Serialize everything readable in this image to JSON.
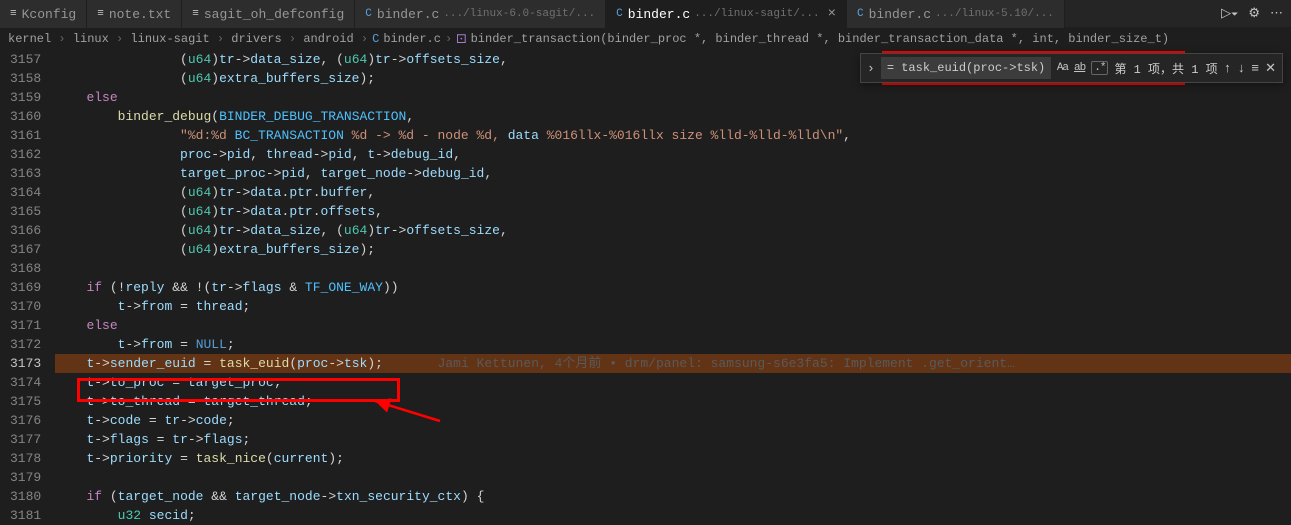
{
  "tabs": [
    {
      "icon": "≡",
      "label": "Kconfig",
      "sub": "",
      "active": false,
      "close": false
    },
    {
      "icon": "≡",
      "label": "note.txt",
      "sub": "",
      "active": false,
      "close": false
    },
    {
      "icon": "≡",
      "label": "sagit_oh_defconfig",
      "sub": "",
      "active": false,
      "close": false
    },
    {
      "icon": "C",
      "label": "binder.c",
      "sub": ".../linux-6.0-sagit/...",
      "active": false,
      "close": false
    },
    {
      "icon": "C",
      "label": "binder.c",
      "sub": ".../linux-sagit/...",
      "active": true,
      "close": true
    },
    {
      "icon": "C",
      "label": "binder.c",
      "sub": ".../linux-5.10/...",
      "active": false,
      "close": false
    }
  ],
  "breadcrumbs": {
    "parts": [
      "kernel",
      "linux",
      "linux-sagit",
      "drivers",
      "android"
    ],
    "file_icon": "C",
    "file": "binder.c",
    "fn_icon": "⚙",
    "fn": "binder_transaction(binder_proc *, binder_thread *, binder_transaction_data *, int, binder_size_t)"
  },
  "find": {
    "value": "= task_euid(proc->tsk);",
    "aa": "Aa",
    "ab": "ab",
    "re": ".*",
    "count": "第 1 项，共 1 项"
  },
  "gutter_start": 3157,
  "lines": [
    "                (u64)tr->data_size, (u64)tr->offsets_size,",
    "                (u64)extra_buffers_size);",
    "    else",
    "        binder_debug(BINDER_DEBUG_TRANSACTION,",
    "                \"%d:%d BC_TRANSACTION %d -> %d - node %d, data %016llx-%016llx size %lld-%lld-%lld\\n\",",
    "                proc->pid, thread->pid, t->debug_id,",
    "                target_proc->pid, target_node->debug_id,",
    "                (u64)tr->data.ptr.buffer,",
    "                (u64)tr->data.ptr.offsets,",
    "                (u64)tr->data_size, (u64)tr->offsets_size,",
    "                (u64)extra_buffers_size);",
    "",
    "    if (!reply && !(tr->flags & TF_ONE_WAY))",
    "        t->from = thread;",
    "    else",
    "        t->from = NULL;",
    "    t->sender_euid = task_euid(proc->tsk);",
    "    t->to_proc = target_proc;",
    "    t->to_thread = target_thread;",
    "    t->code = tr->code;",
    "    t->flags = tr->flags;",
    "    t->priority = task_nice(current);",
    "",
    "    if (target_node && target_node->txn_security_ctx) {",
    "        u32 secid;"
  ],
  "blame": "Jami Kettunen, 4个月前 • drm/panel: samsung-s6e3fa5: Implement .get_orient…",
  "highlight_line_index": 16
}
